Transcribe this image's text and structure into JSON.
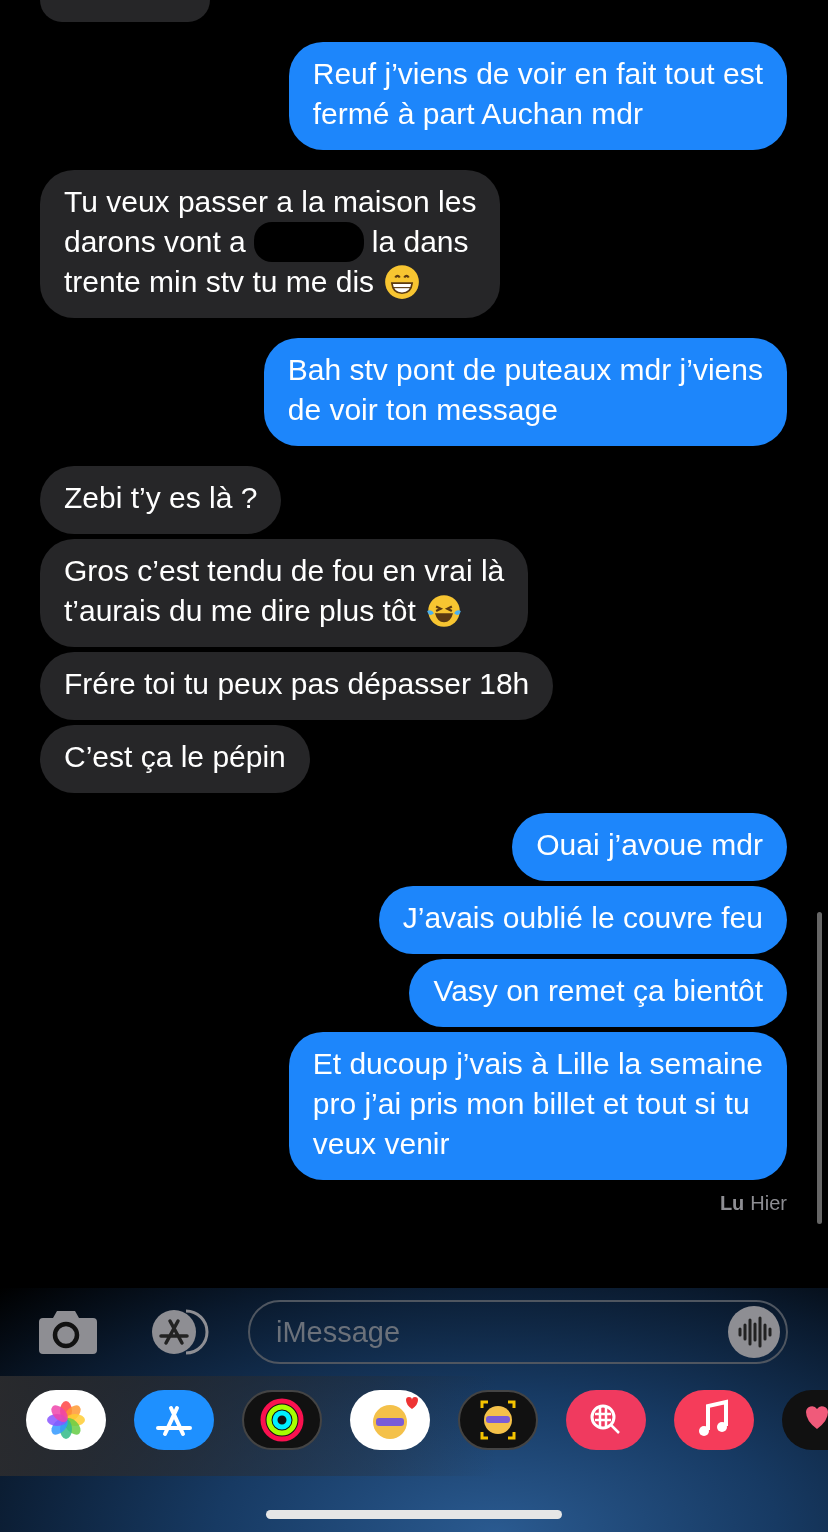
{
  "conversation": {
    "messages": [
      {
        "from_me": false,
        "kind": "cut-off"
      },
      {
        "from_me": true,
        "kind": "plain",
        "text": "Reuf j’viens de voir en fait tout est\nfermé à part Auchan mdr"
      },
      {
        "from_me": false,
        "kind": "lines",
        "lines": [
          [
            {
              "kind": "text",
              "text": "Tu veux passer a la maison les"
            }
          ],
          [
            {
              "kind": "text",
              "text": "darons vont a"
            },
            {
              "kind": "redaction"
            },
            {
              "kind": "text",
              "text": "la dans"
            }
          ],
          [
            {
              "kind": "text",
              "text": "trente min stv tu me dis"
            },
            {
              "kind": "grin-emoji"
            }
          ]
        ]
      },
      {
        "from_me": true,
        "kind": "plain",
        "text": "Bah stv pont de puteaux mdr j’viens\nde voir ton message"
      },
      {
        "from_me": false,
        "kind": "plain",
        "text": "Zebi t’y es là ?"
      },
      {
        "from_me": false,
        "kind": "lines",
        "lines": [
          [
            {
              "kind": "text",
              "text": "Gros c’est tendu de fou en vrai là"
            }
          ],
          [
            {
              "kind": "text",
              "text": "t’aurais du me dire plus tôt"
            },
            {
              "kind": "laugh-emoji"
            }
          ]
        ]
      },
      {
        "from_me": false,
        "kind": "plain",
        "text": "Frére toi tu peux pas dépasser 18h"
      },
      {
        "from_me": false,
        "kind": "plain",
        "text": "C’est ça le pépin"
      },
      {
        "from_me": true,
        "kind": "plain",
        "text": "Ouai j’avoue mdr"
      },
      {
        "from_me": true,
        "kind": "plain",
        "text": "J’avais oublié le couvre feu"
      },
      {
        "from_me": true,
        "kind": "plain",
        "text": "Vasy on remet ça bientôt"
      },
      {
        "from_me": true,
        "kind": "plain",
        "text": "Et ducoup j’vais à Lille la semaine\npro j’ai pris mon billet et tout si tu\nveux venir"
      }
    ]
  },
  "read_receipt": {
    "status": "Lu",
    "time": "Hier"
  },
  "compose": {
    "placeholder": "iMessage"
  },
  "app_drawer": {
    "apps": [
      {
        "kind": "photos"
      },
      {
        "kind": "app-store"
      },
      {
        "kind": "activity"
      },
      {
        "kind": "memoji-stickers"
      },
      {
        "kind": "memoji-camera"
      },
      {
        "kind": "image-search"
      },
      {
        "kind": "music"
      },
      {
        "kind": "heart-stickers"
      }
    ]
  }
}
